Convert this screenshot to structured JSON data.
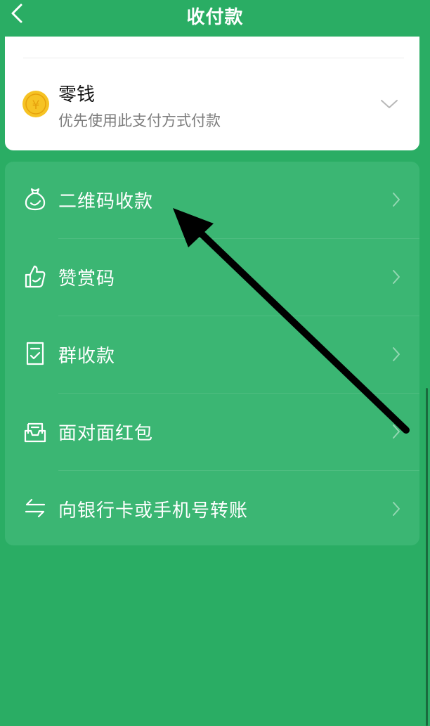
{
  "header": {
    "title": "收付款",
    "back_icon": "back-chevron-icon"
  },
  "payment_method": {
    "name": "零钱",
    "description": "优先使用此支付方式付款",
    "icon": "coin-icon",
    "coin_symbol": "¥",
    "dropdown_icon": "chevron-down-icon"
  },
  "menu": {
    "items": [
      {
        "label": "二维码收款",
        "icon": "money-bag-icon"
      },
      {
        "label": "赞赏码",
        "icon": "thumbs-up-icon"
      },
      {
        "label": "群收款",
        "icon": "bill-icon"
      },
      {
        "label": "面对面红包",
        "icon": "red-packet-icon"
      },
      {
        "label": "向银行卡或手机号转账",
        "icon": "transfer-icon"
      }
    ]
  },
  "colors": {
    "background": "#2aad64",
    "card": "#ffffff",
    "menu_card": "#3bb673",
    "coin": "#f6c324"
  }
}
